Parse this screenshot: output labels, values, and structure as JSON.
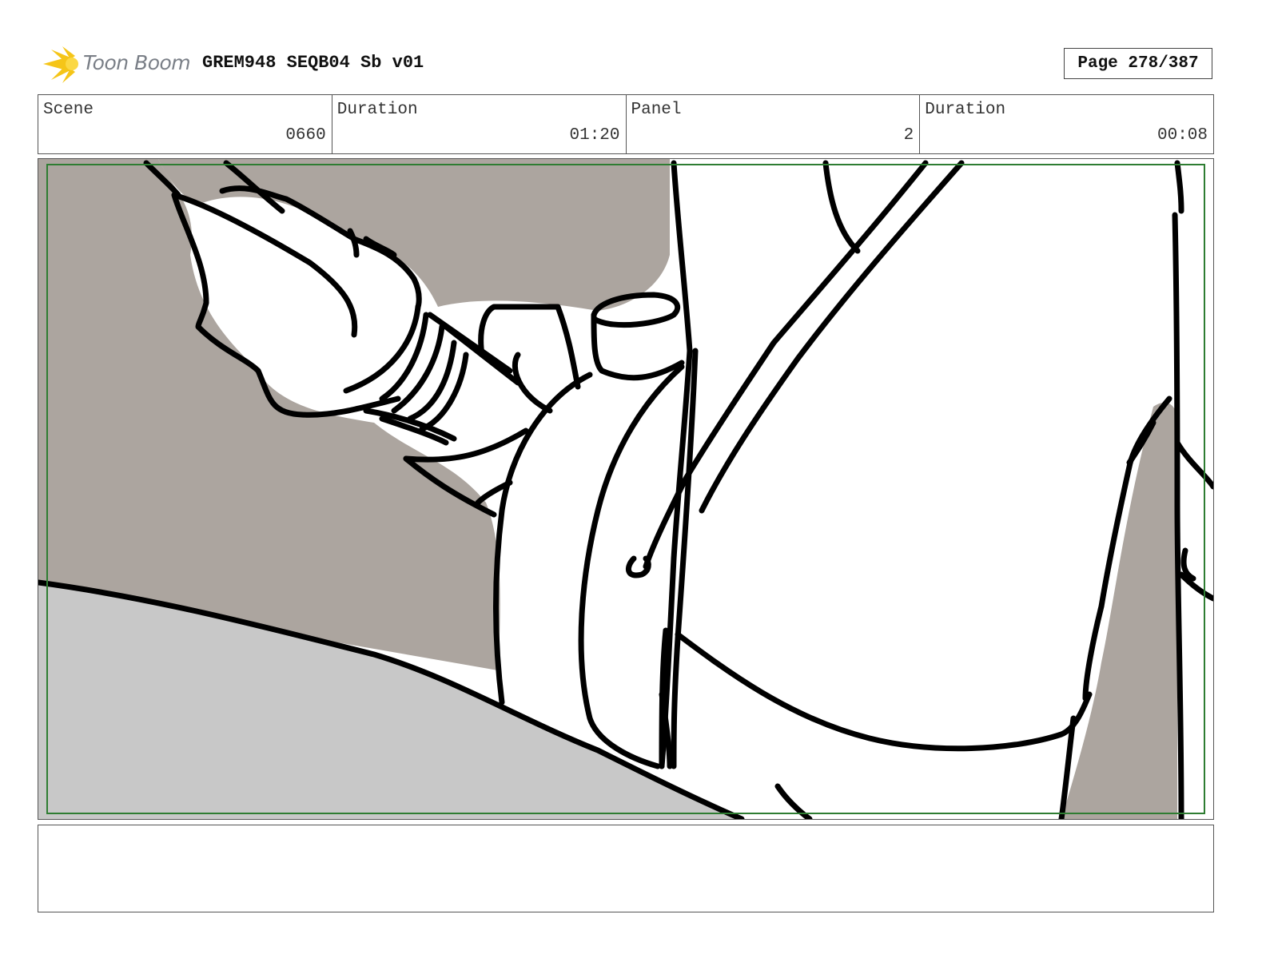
{
  "header": {
    "logo_text": "Toon Boom",
    "title": "GREM948 SEQB04 Sb v01",
    "page": "Page 278/387"
  },
  "info": [
    {
      "label": "Scene",
      "value": "0660"
    },
    {
      "label": "Duration",
      "value": "01:20"
    },
    {
      "label": "Panel",
      "value": "2"
    },
    {
      "label": "Duration",
      "value": "00:08"
    }
  ],
  "colors": {
    "logo_accent": "#f5c518",
    "safe_frame": "#2e7d32",
    "shadow_fill": "#aca59f",
    "ground_fill": "#c8c8c8"
  }
}
